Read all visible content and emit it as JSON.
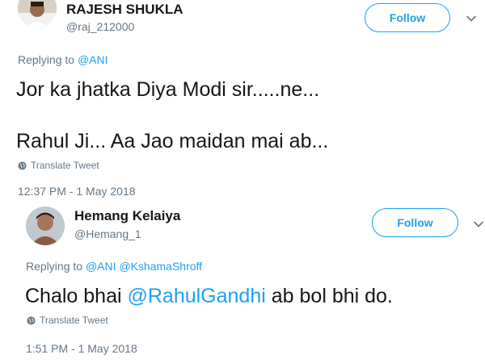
{
  "tweets": [
    {
      "display_name": "RAJESH SHUKLA",
      "handle": "@raj_212000",
      "follow_label": "Follow",
      "replying_prefix": "Replying to",
      "replying_to": "@ANI",
      "text_line1": "Jor ka jhatka Diya Modi sir.....ne...",
      "text_line2": "Rahul Ji... Aa Jao maidan mai ab...",
      "translate_label": "Translate Tweet",
      "timestamp": "12:37 PM - 1 May 2018"
    },
    {
      "display_name": "Hemang Kelaiya",
      "handle": "@Hemang_1",
      "follow_label": "Follow",
      "replying_prefix": "Replying to",
      "replying_to": "@ANI @KshamaShroff",
      "text_before": "Chalo bhai ",
      "text_mention": "@RahulGandhi",
      "text_after": " ab bol bhi do.",
      "translate_label": "Translate Tweet",
      "timestamp": "1:51 PM - 1 May 2018"
    }
  ],
  "colors": {
    "accent": "#1da1f2",
    "secondary_text": "#657786",
    "primary_text": "#14171a"
  },
  "icons": {
    "chevron": "chevron-down-icon",
    "translate": "globe-icon",
    "avatar": "avatar"
  }
}
